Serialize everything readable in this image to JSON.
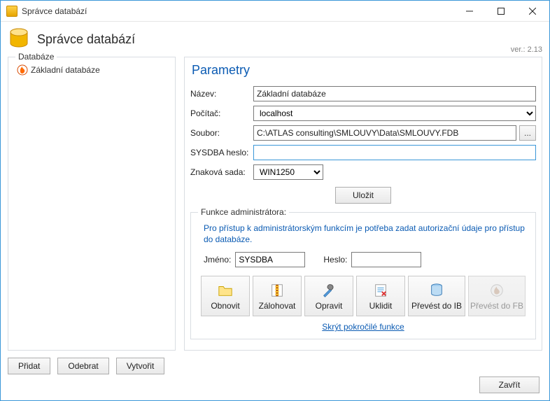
{
  "window": {
    "title": "Správce databází"
  },
  "header": {
    "title": "Správce databází",
    "version": "ver.: 2.13"
  },
  "left": {
    "group_title": "Databáze",
    "items": [
      {
        "label": "Základní databáze"
      }
    ],
    "buttons": {
      "add": "Přidat",
      "remove": "Odebrat",
      "create": "Vytvořit"
    }
  },
  "params": {
    "title": "Parametry",
    "labels": {
      "name": "Název:",
      "computer": "Počítač:",
      "file": "Soubor:",
      "sysdba_pw": "SYSDBA heslo:",
      "charset": "Znaková sada:"
    },
    "values": {
      "name": "Základní databáze",
      "computer": "localhost",
      "file": "C:\\ATLAS consulting\\SMLOUVY\\Data\\SMLOUVY.FDB",
      "sysdba_pw": "",
      "charset": "WIN1250"
    },
    "browse_label": "...",
    "save_button": "Uložit"
  },
  "admin": {
    "group_title": "Funkce administrátora:",
    "info": "Pro přístup k administrátorským funkcím je potřeba zadat autorizační údaje pro přístup do databáze.",
    "labels": {
      "user": "Jméno:",
      "password": "Heslo:"
    },
    "values": {
      "user": "SYSDBA",
      "password": ""
    },
    "tools": {
      "restore": "Obnovit",
      "backup": "Zálohovat",
      "repair": "Opravit",
      "cleanup": "Uklidit",
      "to_ib": "Převést do IB",
      "to_fb": "Převést do FB"
    },
    "hide_link": "Skrýt pokročilé funkce"
  },
  "footer": {
    "close": "Zavřít"
  }
}
